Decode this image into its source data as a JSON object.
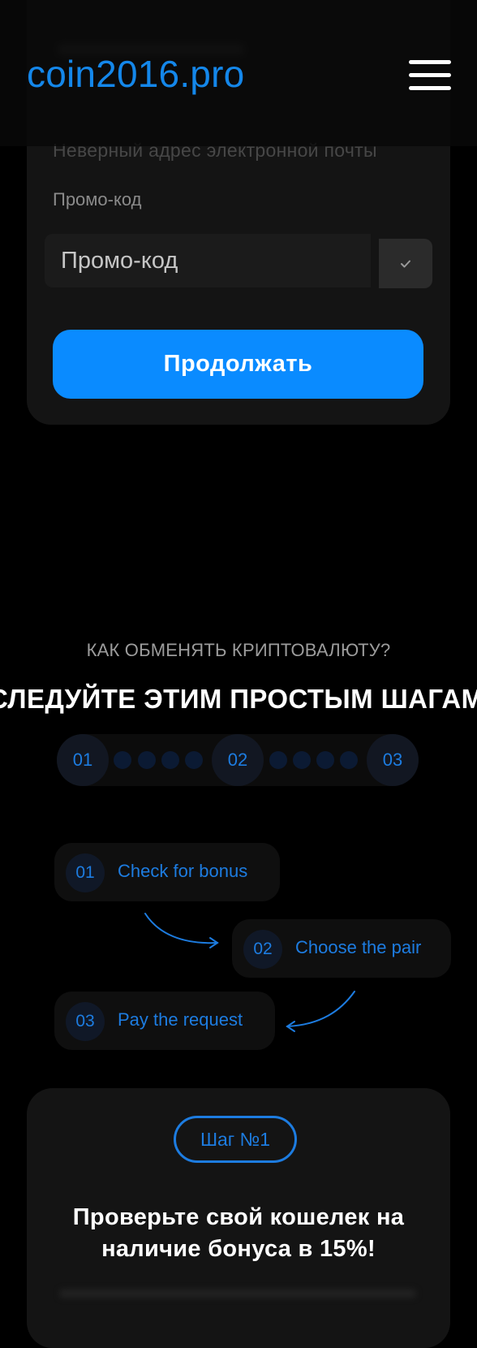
{
  "header": {
    "logo": "coin2016.pro",
    "menu_icon": "hamburger-menu-icon"
  },
  "form": {
    "email_error": "Неверный адрес электронной почты",
    "promo_label": "Промо-код",
    "promo_placeholder": "Промо-код",
    "promo_check_icon": "checkmark-icon",
    "continue_label": "Продолжать"
  },
  "steps_section": {
    "subtitle": "КАК ОБМЕНЯТЬ КРИПТОВАЛЮТУ?",
    "title": "СЛЕДУЙТЕ ЭТИМ ПРОСТЫМ ШАГАМ:",
    "progress": [
      "01",
      "02",
      "03"
    ],
    "steps": [
      {
        "num": "01",
        "label": "Check for bonus"
      },
      {
        "num": "02",
        "label": "Choose the pair"
      },
      {
        "num": "03",
        "label": "Pay the request"
      }
    ]
  },
  "info_card": {
    "badge": "Шаг №1",
    "title": "Проверьте свой кошелек на наличие бонуса в 15%!"
  },
  "colors": {
    "accent": "#0a8bff",
    "accent_text": "#1d7ce0",
    "background": "#000000",
    "card": "#141414"
  }
}
